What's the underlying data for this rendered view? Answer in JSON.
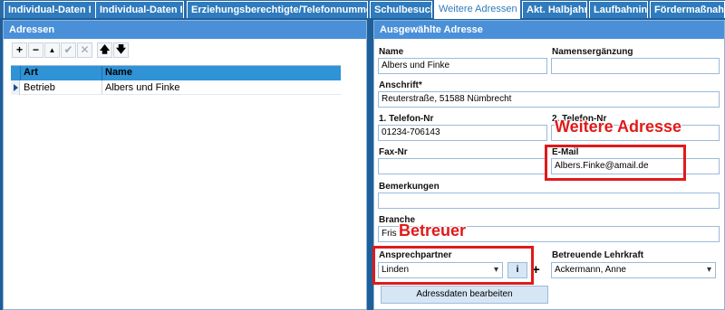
{
  "tabs": [
    {
      "label": "Individual-Daten I"
    },
    {
      "label": "Individual-Daten II"
    },
    {
      "label": "Erziehungsberechtigte/Telefonnummern"
    },
    {
      "label": "Schulbesuch"
    },
    {
      "label": "Weitere Adressen"
    },
    {
      "label": "Akt. Halbjahr"
    },
    {
      "label": "Laufbahninfo"
    },
    {
      "label": "Fördermaßnah"
    }
  ],
  "left_panel": {
    "title": "Adressen",
    "toolbar": {
      "add": "+",
      "remove": "−",
      "up_small": "▲",
      "confirm": "✔",
      "cancel": "✕",
      "move_up": "🡅",
      "move_down": "🡇"
    },
    "grid": {
      "columns": [
        "Art",
        "Name"
      ],
      "rows": [
        {
          "art": "Betrieb",
          "name": "Albers und Finke"
        }
      ]
    }
  },
  "right_panel": {
    "title": "Ausgewählte Adresse",
    "name_label": "Name",
    "name_value": "Albers und Finke",
    "namenserg_label": "Namensergänzung",
    "namenserg_value": "",
    "anschrift_label": "Anschrift*",
    "anschrift_value": "Reuterstraße, 51588 Nümbrecht",
    "tel1_label": "1. Telefon-Nr",
    "tel1_value": "01234-706143",
    "tel2_label": "2. Telefon-Nr",
    "tel2_value": "",
    "fax_label": "Fax-Nr",
    "fax_value": "",
    "email_label": "E-Mail",
    "email_value": "Albers.Finke@amail.de",
    "bemerkungen_label": "Bemerkungen",
    "bemerkungen_value": "",
    "branche_label": "Branche",
    "branche_value": "Fris",
    "ansprechpartner_label": "Ansprechpartner",
    "ansprechpartner_value": "Linden",
    "info_button": "i",
    "plus_button": "+",
    "lehrkraft_label": "Betreuende Lehrkraft",
    "lehrkraft_value": "Ackermann, Anne",
    "edit_button": "Adressdaten bearbeiten"
  },
  "annotations": {
    "weitere_adresse": "Weitere Adresse",
    "betreuer": "Betreuer"
  },
  "colors": {
    "accent": "#2f7bbd",
    "header": "#4a90d9",
    "annotation": "#e01a1a"
  }
}
